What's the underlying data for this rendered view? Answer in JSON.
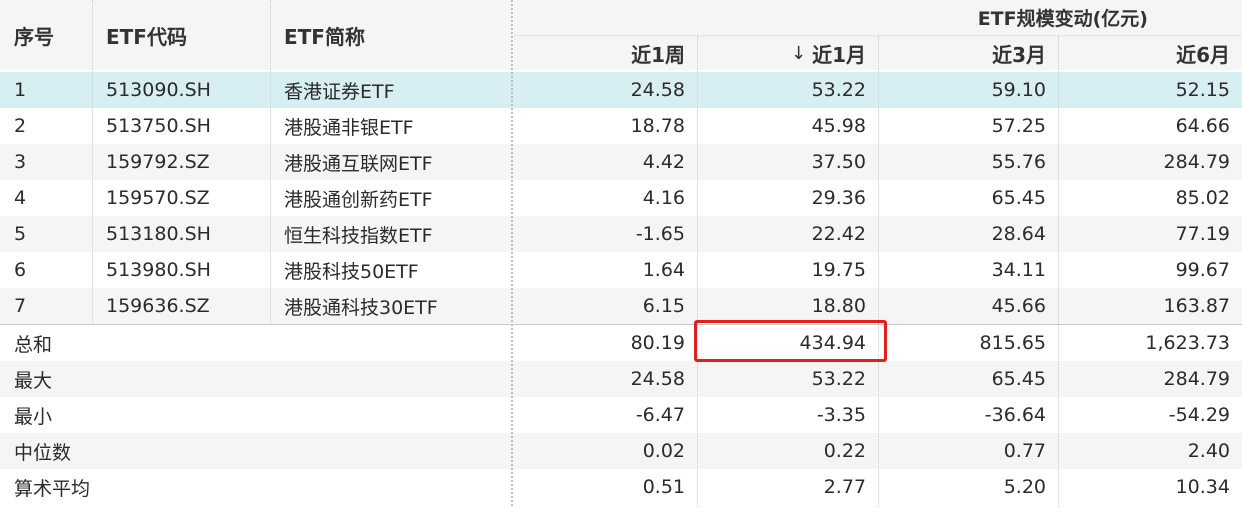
{
  "header": {
    "col_index": "序号",
    "col_code": "ETF代码",
    "col_name": "ETF简称",
    "group_title": "ETF规模变动(亿元)",
    "col_1w": "近1周",
    "col_1m": "近1月",
    "col_1m_sort_icon": "↓",
    "col_3m": "近3月",
    "col_6m": "近6月"
  },
  "rows": [
    {
      "idx": "1",
      "code": "513090.SH",
      "name": "香港证券ETF",
      "w1": "24.58",
      "m1": "53.22",
      "m3": "59.10",
      "m6": "52.15"
    },
    {
      "idx": "2",
      "code": "513750.SH",
      "name": "港股通非银ETF",
      "w1": "18.78",
      "m1": "45.98",
      "m3": "57.25",
      "m6": "64.66"
    },
    {
      "idx": "3",
      "code": "159792.SZ",
      "name": "港股通互联网ETF",
      "w1": "4.42",
      "m1": "37.50",
      "m3": "55.76",
      "m6": "284.79"
    },
    {
      "idx": "4",
      "code": "159570.SZ",
      "name": "港股通创新药ETF",
      "w1": "4.16",
      "m1": "29.36",
      "m3": "65.45",
      "m6": "85.02"
    },
    {
      "idx": "5",
      "code": "513180.SH",
      "name": "恒生科技指数ETF",
      "w1": "-1.65",
      "m1": "22.42",
      "m3": "28.64",
      "m6": "77.19"
    },
    {
      "idx": "6",
      "code": "513980.SH",
      "name": "港股科技50ETF",
      "w1": "1.64",
      "m1": "19.75",
      "m3": "34.11",
      "m6": "99.67"
    },
    {
      "idx": "7",
      "code": "159636.SZ",
      "name": "港股通科技30ETF",
      "w1": "6.15",
      "m1": "18.80",
      "m3": "45.66",
      "m6": "163.87"
    }
  ],
  "summary": [
    {
      "label": "总和",
      "w1": "80.19",
      "m1": "434.94",
      "m3": "815.65",
      "m6": "1,623.73"
    },
    {
      "label": "最大",
      "w1": "24.58",
      "m1": "53.22",
      "m3": "65.45",
      "m6": "284.79"
    },
    {
      "label": "最小",
      "w1": "-6.47",
      "m1": "-3.35",
      "m3": "-36.64",
      "m6": "-54.29"
    },
    {
      "label": "中位数",
      "w1": "0.02",
      "m1": "0.22",
      "m3": "0.77",
      "m6": "2.40"
    },
    {
      "label": "算术平均",
      "w1": "0.51",
      "m1": "2.77",
      "m3": "5.20",
      "m6": "10.34"
    }
  ],
  "colors": {
    "selected_row": "#d7eef3",
    "stripe_row": "#f5f5f5",
    "header_bg": "#f5f5f5",
    "highlight_border": "#e02020"
  }
}
